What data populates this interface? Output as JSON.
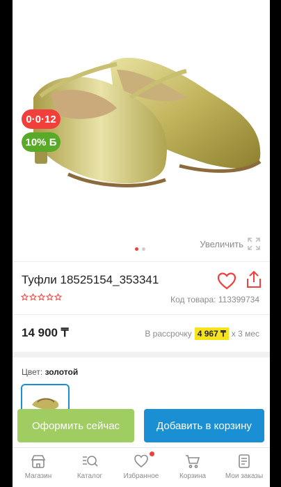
{
  "product": {
    "badge_installment": "0·0·12",
    "badge_bonus": "10% Б",
    "zoom_label": "Увеличить",
    "title": "Туфли 18525154_353341",
    "code": "Код товара: 113399734",
    "rating": 0,
    "price": "14 900 ₸",
    "installment_prefix": "В рассрочку",
    "installment_amount": "4 967 ₸",
    "installment_suffix": "x 3 мес",
    "color_label": "Цвет:",
    "color_value": "золотой",
    "carousel_total": 2,
    "carousel_active": 1
  },
  "actions": {
    "order_now": "Оформить сейчас",
    "add_to_cart": "Добавить в корзину"
  },
  "tabbar": {
    "items": [
      {
        "label": "Магазин",
        "icon": "store-icon"
      },
      {
        "label": "Каталог",
        "icon": "catalog-search-icon"
      },
      {
        "label": "Избранное",
        "icon": "heart-icon"
      },
      {
        "label": "Корзина",
        "icon": "cart-icon"
      },
      {
        "label": "Мои заказы",
        "icon": "orders-icon"
      }
    ]
  },
  "colors": {
    "accent_red": "#f1403c",
    "accent_green": "#9fcd62",
    "accent_blue": "#1a8fd3",
    "highlight_yellow": "#f7e31c"
  }
}
